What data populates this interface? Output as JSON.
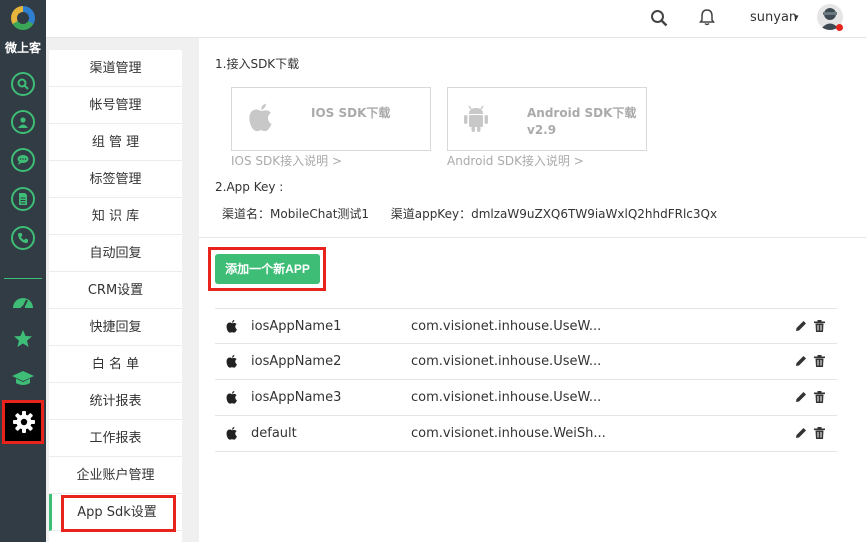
{
  "brand": {
    "name": "微上客"
  },
  "topbar": {
    "username": "sunyan",
    "caret": "▾"
  },
  "rail": {
    "icons": [
      "search-icon",
      "user-icon",
      "chat-icon",
      "document-icon",
      "phone-icon",
      "dashboard-icon",
      "star-icon",
      "graduation-cap-icon",
      "gear-icon"
    ],
    "accent": "#3ebd76",
    "highlight": "#e8231c"
  },
  "subnav": {
    "items": [
      {
        "label": "渠道管理"
      },
      {
        "label": "帐号管理"
      },
      {
        "label": "组 管 理"
      },
      {
        "label": "标签管理"
      },
      {
        "label": "知 识 库"
      },
      {
        "label": "自动回复"
      },
      {
        "label": "CRM设置"
      },
      {
        "label": "快捷回复"
      },
      {
        "label": "白 名 单"
      },
      {
        "label": "统计报表"
      },
      {
        "label": "工作报表"
      },
      {
        "label": "企业账户管理"
      },
      {
        "label": "App Sdk设置"
      }
    ],
    "active_index": 12
  },
  "sdk": {
    "section_title": "1.接入SDK下载",
    "ios": {
      "label": "IOS SDK下载",
      "link": "IOS SDK接入说明 >"
    },
    "android": {
      "label_line1": "Android SDK下载",
      "label_line2": "v2.9",
      "link": "Android SDK接入说明 >"
    }
  },
  "appkey": {
    "section_title": "2.App Key :",
    "channel_label": "渠道名：",
    "channel_value": "MobileChat测试1",
    "key_label": "渠道appKey：",
    "key_value": "dmlzaW9uZXQ6TW9iaWxlQ2hhdFRlc3Qx"
  },
  "add_button": {
    "label": "添加一个新APP"
  },
  "apps": [
    {
      "name": "iosAppName1",
      "bundle": "com.visionet.inhouse.UseW..."
    },
    {
      "name": "iosAppName2",
      "bundle": "com.visionet.inhouse.UseW..."
    },
    {
      "name": "iosAppName3",
      "bundle": "com.visionet.inhouse.UseW..."
    },
    {
      "name": "default",
      "bundle": "com.visionet.inhouse.WeiSh..."
    }
  ]
}
